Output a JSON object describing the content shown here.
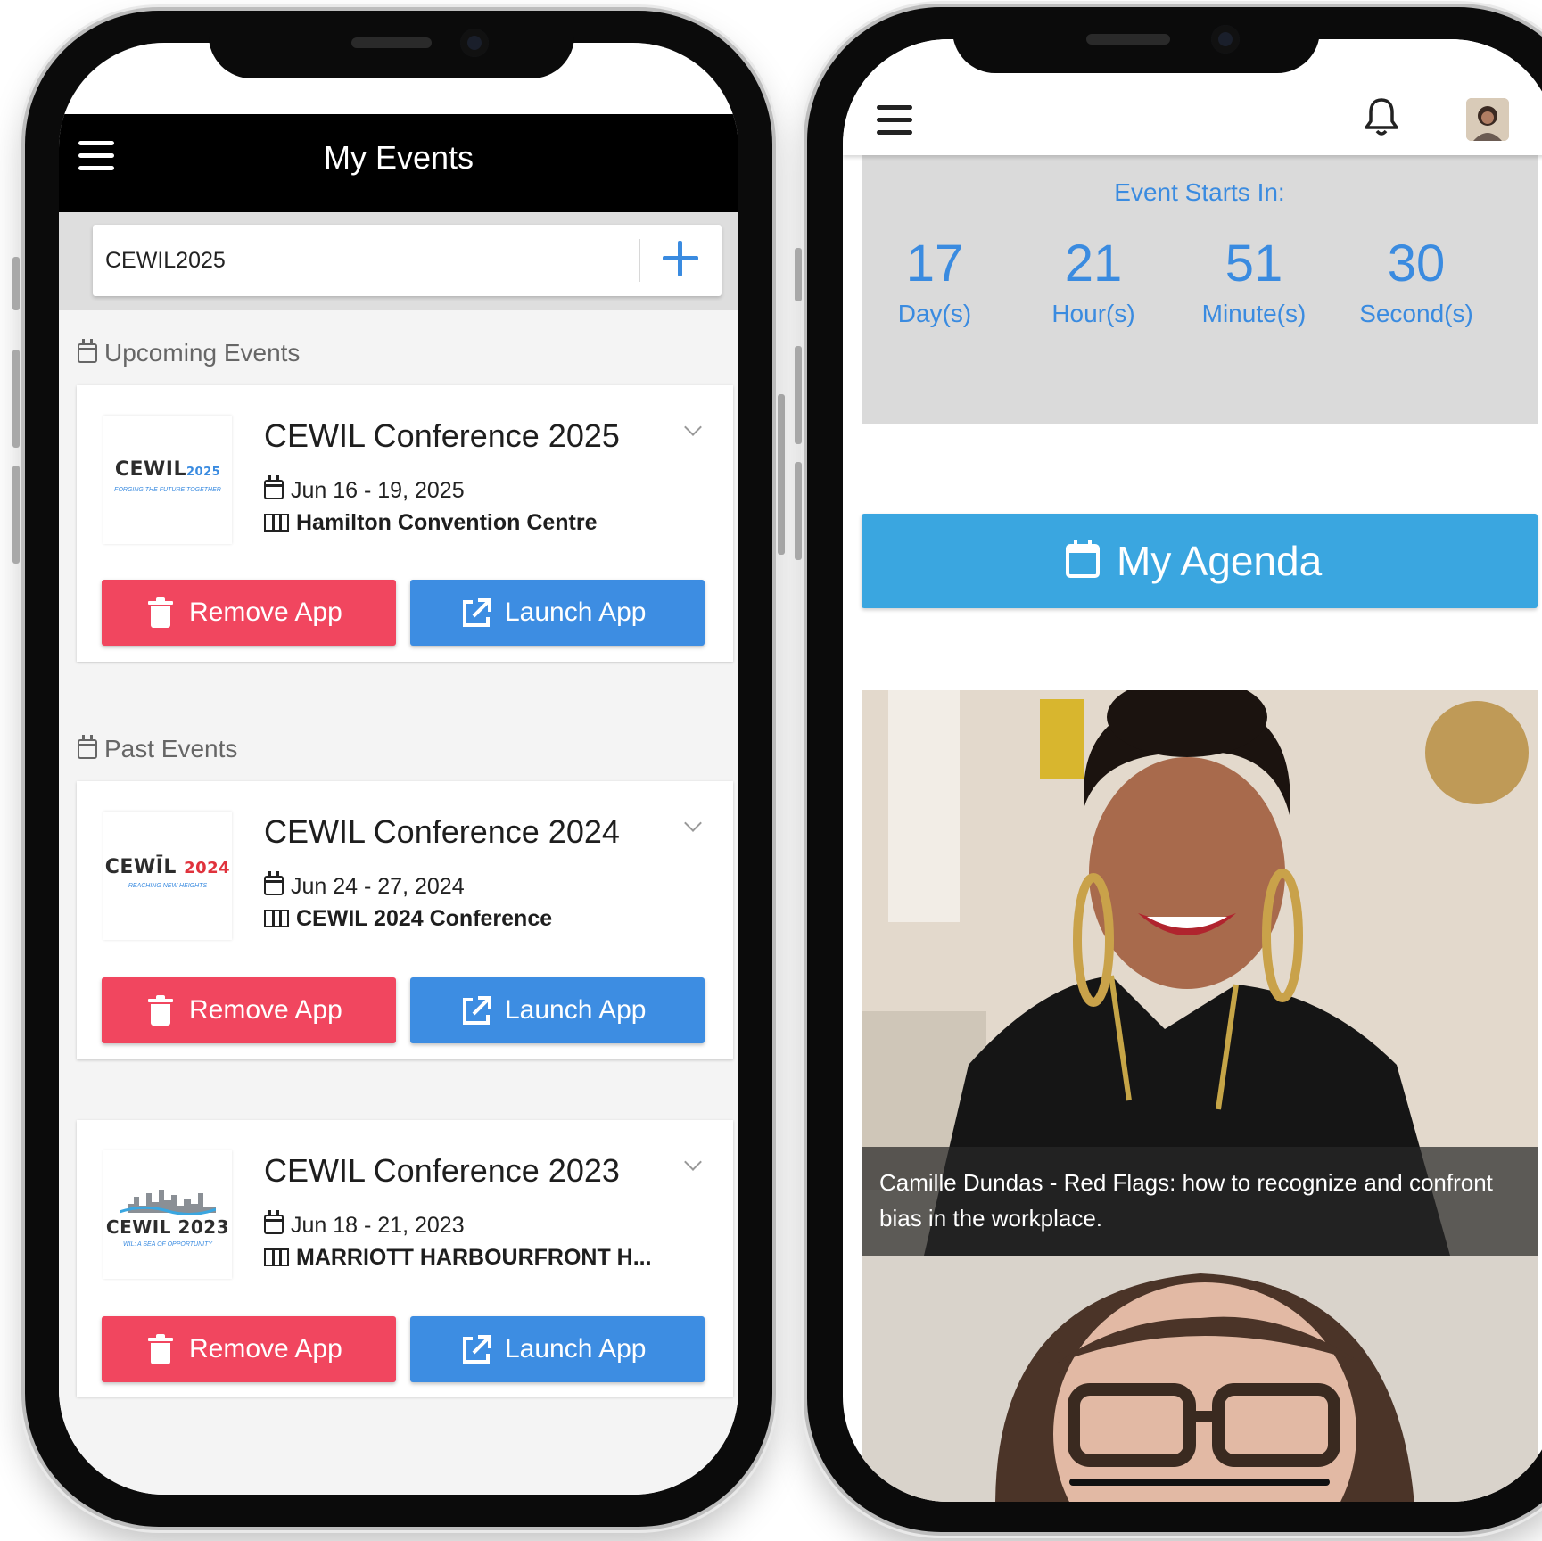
{
  "left_phone": {
    "header_title": "My Events",
    "search": {
      "value": "CEWIL2025"
    },
    "sections": {
      "upcoming": "Upcoming Events",
      "past": "Past Events"
    },
    "events": [
      {
        "title": "CEWIL Conference 2025",
        "date": "Jun 16 - 19, 2025",
        "location": "Hamilton Convention Centre",
        "logo_text": "CEWIL",
        "logo_year": "2025",
        "logo_tagline": "FORGING THE FUTURE TOGETHER"
      },
      {
        "title": "CEWIL Conference 2024",
        "date": "Jun 24 - 27, 2024",
        "location": "CEWIL 2024 Conference",
        "logo_text": "CEWĪL",
        "logo_year": "2024",
        "logo_tagline": "REACHING NEW HEIGHTS"
      },
      {
        "title": "CEWIL Conference 2023",
        "date": "Jun 18 - 21, 2023",
        "location": "MARRIOTT HARBOURFRONT H...",
        "logo_text": "CEWIL 2023",
        "logo_year": "",
        "logo_tagline": "WIL: A SEA OF OPPORTUNITY"
      }
    ],
    "buttons": {
      "remove": "Remove App",
      "launch": "Launch App"
    }
  },
  "right_phone": {
    "countdown": {
      "title": "Event Starts In:",
      "days": "17",
      "days_label": "Day(s)",
      "hours": "21",
      "hours_label": "Hour(s)",
      "minutes": "51",
      "minutes_label": "Minute(s)",
      "seconds": "30",
      "seconds_label": "Second(s)"
    },
    "agenda_button": "My Agenda",
    "feature_caption": "Camille Dundas - Red Flags: how to recognize and confront bias in the workplace."
  },
  "colors": {
    "remove_red": "#f1465f",
    "launch_blue": "#3d8de2",
    "agenda_blue": "#3aa6e0",
    "countdown_text": "#3a8be0",
    "header_black": "#000000"
  },
  "icons": [
    "menu-icon",
    "plus-icon",
    "calendar-icon",
    "map-icon",
    "chevron-down-icon",
    "trash-icon",
    "external-link-icon",
    "bell-icon",
    "avatar"
  ]
}
